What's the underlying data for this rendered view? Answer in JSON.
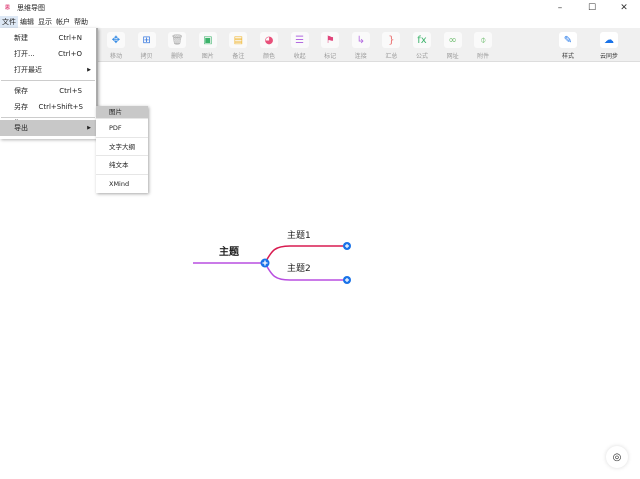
{
  "window": {
    "title": "思维导图",
    "app_icon": "思"
  },
  "menubar": [
    "文件",
    "编辑",
    "显示",
    "帐户",
    "帮助"
  ],
  "toolbar": {
    "items": [
      {
        "label": "移动",
        "icon": "move-icon",
        "glyph": "✥",
        "color": "#3a8ee6"
      },
      {
        "label": "拷贝",
        "icon": "copy-icon",
        "glyph": "⊞",
        "color": "#3a7be0"
      },
      {
        "label": "删除",
        "icon": "trash-icon",
        "glyph": "🗑",
        "color": "#aaaaaa"
      },
      {
        "label": "图片",
        "icon": "image-icon",
        "glyph": "▣",
        "color": "#3db36b"
      },
      {
        "label": "备注",
        "icon": "note-icon",
        "glyph": "▤",
        "color": "#f0b429"
      },
      {
        "label": "颜色",
        "icon": "palette-icon",
        "glyph": "◕",
        "color": "#e8507a"
      },
      {
        "label": "收起",
        "icon": "collapse-icon",
        "glyph": "☰",
        "color": "#b36be0"
      },
      {
        "label": "标记",
        "icon": "flag-icon",
        "glyph": "⚑",
        "color": "#e0457b"
      },
      {
        "label": "连接",
        "icon": "connect-icon",
        "glyph": "↳",
        "color": "#b36be0"
      },
      {
        "label": "汇总",
        "icon": "summary-icon",
        "glyph": "}",
        "color": "#e86a6a"
      },
      {
        "label": "公式",
        "icon": "formula-icon",
        "glyph": "fx",
        "color": "#3db36b"
      },
      {
        "label": "网址",
        "icon": "link-icon",
        "glyph": "∞",
        "color": "#7ac27a"
      },
      {
        "label": "附件",
        "icon": "attachment-icon",
        "glyph": "⌽",
        "color": "#7ac27a"
      }
    ],
    "right": [
      {
        "label": "样式",
        "icon": "style-brush-icon",
        "glyph": "✎",
        "color": "#1a73e8"
      },
      {
        "label": "云同步",
        "icon": "cloud-sync-icon",
        "glyph": "☁",
        "color": "#1a73e8"
      }
    ]
  },
  "file_menu": {
    "new": "新建",
    "new_sc": "Ctrl+N",
    "open": "打开...",
    "open_sc": "Ctrl+O",
    "recent": "打开最近",
    "save": "保存",
    "save_sc": "Ctrl+S",
    "save_as": "另存为...",
    "save_as_sc": "Ctrl+Shift+S",
    "export": "导出"
  },
  "export_menu": [
    "图片",
    "PDF",
    "文字大纲",
    "纯文本",
    "XMind"
  ],
  "mindmap": {
    "root": "主题",
    "children": [
      "主题1",
      "主题2"
    ],
    "colors": {
      "root_line": "#b84ee0",
      "child1": "#d81b50",
      "child2": "#b84ee0",
      "node_dot": "#1a73e8"
    }
  }
}
